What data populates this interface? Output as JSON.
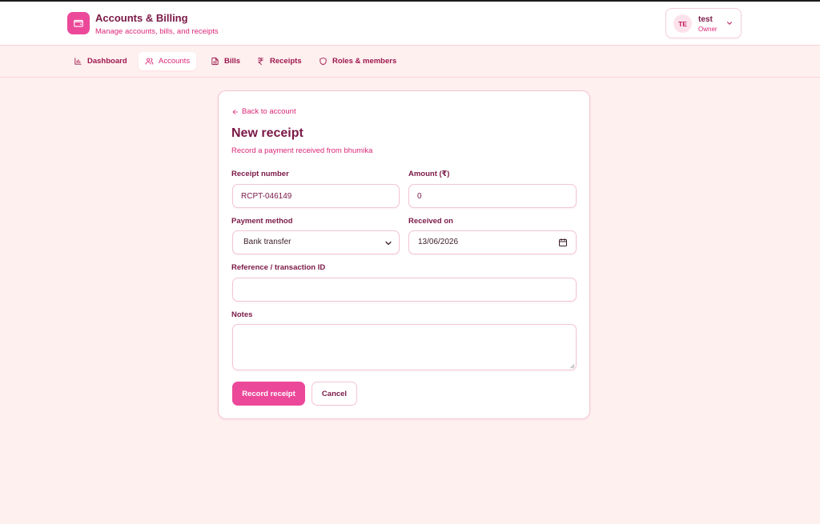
{
  "app": {
    "title": "Accounts & Billing",
    "subtitle": "Manage accounts, bills, and receipts",
    "logo_icon": "wallet-icon"
  },
  "user": {
    "initials": "TE",
    "name": "test",
    "role": "Owner"
  },
  "nav": {
    "tabs": [
      {
        "label": "Dashboard",
        "icon": "bar-chart-icon",
        "active": false
      },
      {
        "label": "Accounts",
        "icon": "users-icon",
        "active": true
      },
      {
        "label": "Bills",
        "icon": "document-icon",
        "active": false
      },
      {
        "label": "Receipts",
        "icon": "rupee-icon",
        "active": false
      },
      {
        "label": "Roles & members",
        "icon": "shield-icon",
        "active": false
      }
    ]
  },
  "form": {
    "back_label": "Back to account",
    "title": "New receipt",
    "subtitle": "Record a payment received from bhumika",
    "receipt_number": {
      "label": "Receipt number",
      "value": "RCPT-046149"
    },
    "amount": {
      "label": "Amount (₹)",
      "value": "0"
    },
    "payment_method": {
      "label": "Payment method",
      "value": "Bank transfer"
    },
    "received_on": {
      "label": "Received on",
      "value": "13/06/2026"
    },
    "reference": {
      "label": "Reference / transaction ID",
      "value": ""
    },
    "notes": {
      "label": "Notes",
      "value": ""
    },
    "submit_label": "Record receipt",
    "cancel_label": "Cancel"
  },
  "colors": {
    "accent": "#ec4899",
    "text": "#7a1846",
    "background": "#fff0f0",
    "border": "#f3c5d3"
  }
}
